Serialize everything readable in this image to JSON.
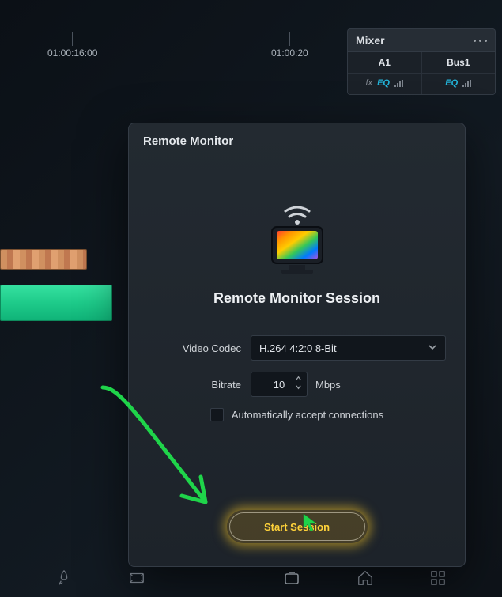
{
  "timeline": {
    "ticks": [
      "01:00:16:00",
      "01:00:20"
    ]
  },
  "mixer": {
    "title": "Mixer",
    "tracks": [
      {
        "name": "A1",
        "fx_label": "fx",
        "eq_label": "EQ"
      },
      {
        "name": "Bus1",
        "fx_label": "",
        "eq_label": "EQ"
      }
    ]
  },
  "dialog": {
    "title": "Remote Monitor",
    "session_heading": "Remote Monitor Session",
    "codec_label": "Video Codec",
    "codec_value": "H.264 4:2:0 8-Bit",
    "bitrate_label": "Bitrate",
    "bitrate_value": "10",
    "bitrate_unit": "Mbps",
    "auto_accept_label": "Automatically accept connections",
    "auto_accept_checked": false,
    "start_button": "Start Session"
  }
}
